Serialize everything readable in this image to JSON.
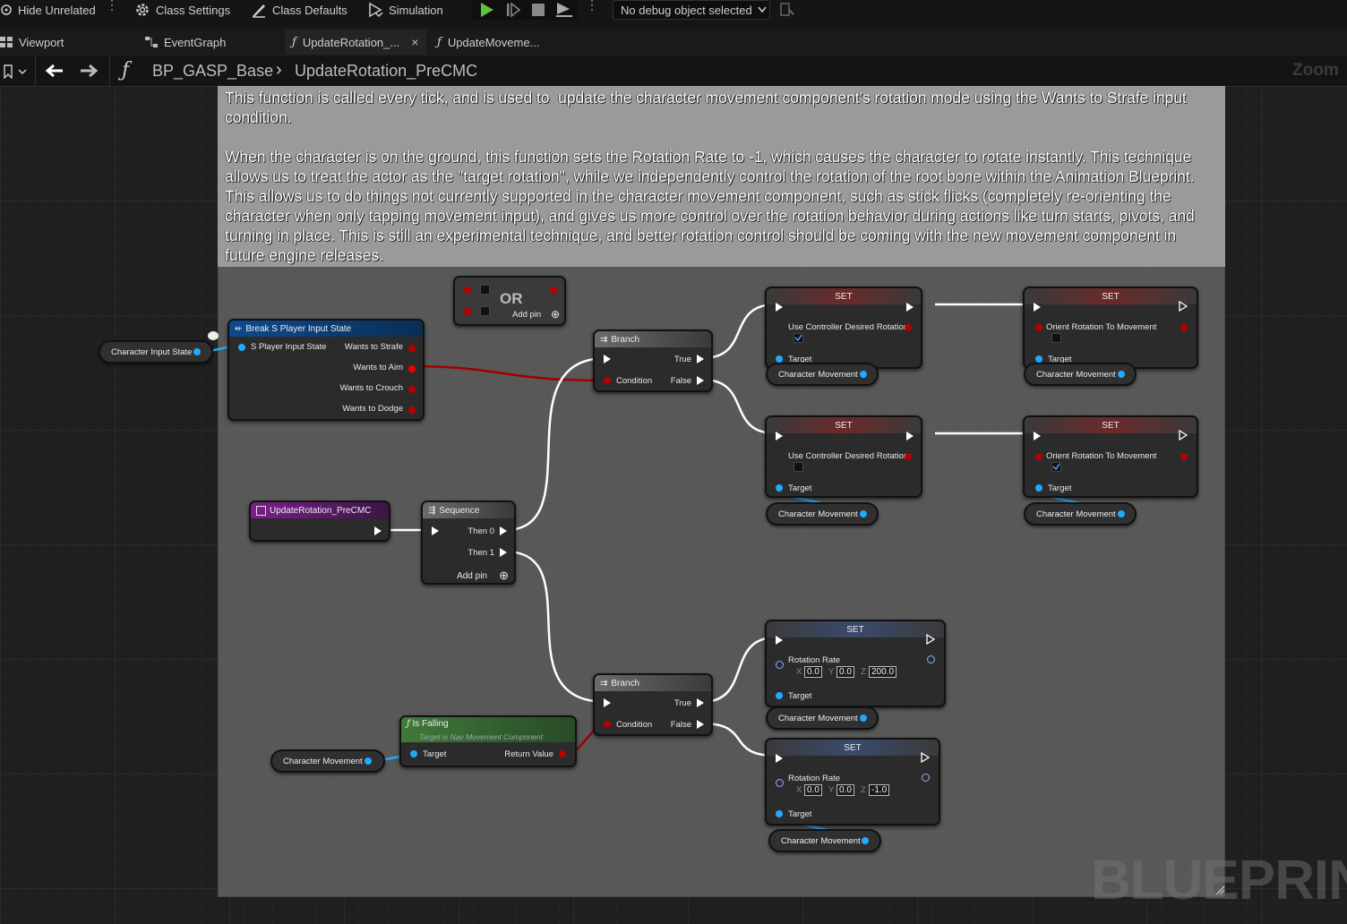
{
  "toolbar": {
    "hide_unrelated": "Hide Unrelated",
    "class_settings": "Class Settings",
    "class_defaults": "Class Defaults",
    "simulation": "Simulation",
    "debug_object": "No debug object selected"
  },
  "tabs": [
    {
      "label": "Viewport"
    },
    {
      "label": "EventGraph"
    },
    {
      "label": "UpdateRotation_..."
    },
    {
      "label": "UpdateMoveme..."
    }
  ],
  "breadcrumb": {
    "root": "BP_GASP_Base",
    "current": "UpdateRotation_PreCMC",
    "zoom": "Zoom -"
  },
  "comment": {
    "text": "This function is called every tick, and is used to  update the character movement component's rotation mode using the Wants to Strafe input condition.\n\nWhen the character is on the ground, this function sets the Rotation Rate to -1, which causes the character to rotate instantly. This technique allows us to treat the actor as the \"target rotation\", while we independently control the rotation of the root bone within the Animation Blueprint. This allows us to do things not currently supported in the character movement component, such as stick flicks (completely re-orienting the character when only tapping movement input), and gives us more control over the rotation behavior during actions like turn starts, pivots, and turning in place. This is still an experimental technique, and better rotation control should be coming with the new movement component in future engine releases."
  },
  "nodes": {
    "character_input_state": "Character Input State",
    "break": {
      "title": "Break S Player Input State",
      "input": "S Player Input State",
      "outputs": [
        "Wants to Strafe",
        "Wants to Aim",
        "Wants to Crouch",
        "Wants to Dodge"
      ]
    },
    "or": {
      "title": "OR",
      "add_pin": "Add pin"
    },
    "entry": {
      "title": "UpdateRotation_PreCMC"
    },
    "sequence": {
      "title": "Sequence",
      "then0": "Then 0",
      "then1": "Then 1",
      "add_pin": "Add pin"
    },
    "branch1": {
      "title": "Branch",
      "true": "True",
      "false": "False",
      "condition": "Condition"
    },
    "branch2": {
      "title": "Branch",
      "true": "True",
      "false": "False",
      "condition": "Condition"
    },
    "is_falling": {
      "title": "Is Falling",
      "subtitle": "Target is Nav Movement Component",
      "target": "Target",
      "return": "Return Value"
    },
    "char_movement": "Character Movement",
    "set_title": "SET",
    "use_controller": "Use Controller Desired Rotation",
    "orient_rotation": "Orient Rotation To Movement",
    "target": "Target",
    "rotation_rate": "Rotation Rate",
    "rr1": {
      "x": "0.0",
      "y": "0.0",
      "z": "200.0"
    },
    "rr2": {
      "x": "0.0",
      "y": "0.0",
      "z": "-1.0"
    },
    "axis": {
      "x": "X",
      "y": "Y",
      "z": "Z"
    }
  },
  "watermark": "BLUEPRINT"
}
